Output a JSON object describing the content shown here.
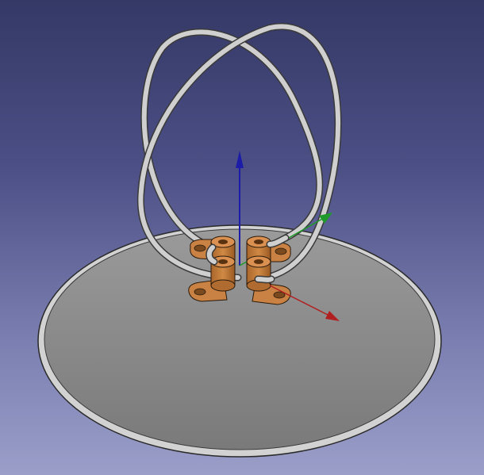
{
  "viewport": {
    "background_top": "#353966",
    "background_bottom": "#9a9ec8"
  },
  "scene": {
    "objects": [
      "ground-plane-disc",
      "loop-antenna-wire-a",
      "loop-antenna-wire-b",
      "antenna-mount-brackets"
    ],
    "colors": {
      "disc_face": "#8c8c8c",
      "disc_rim": "#cfcfcf",
      "wire": "#c8c8c8",
      "bracket": "#c07a3a"
    }
  },
  "axis_triad": {
    "x_color": "#b02020",
    "y_color": "#1f9a2a",
    "z_color": "#1c1ca8"
  }
}
